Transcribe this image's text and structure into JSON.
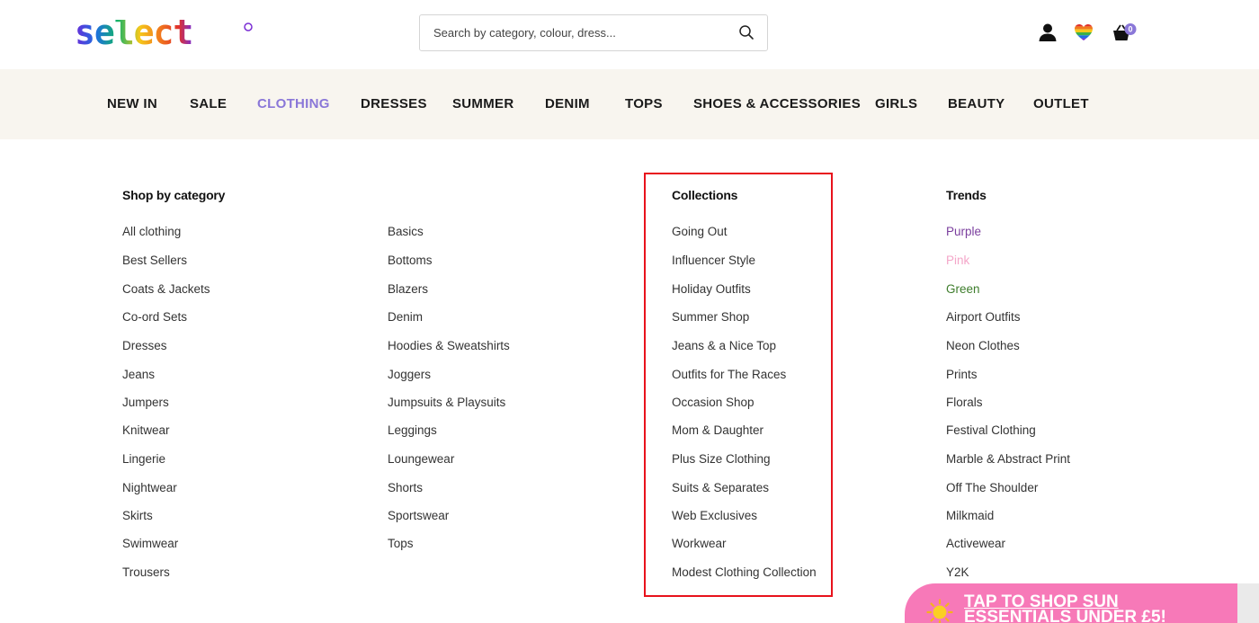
{
  "brand": {
    "logo_text": "select"
  },
  "search": {
    "placeholder": "Search by category, colour, dress..."
  },
  "header_icons": {
    "account": "user-icon",
    "wishlist": "rainbow-heart-icon",
    "basket": "basket-icon",
    "basket_count": "0"
  },
  "nav": {
    "items": [
      "NEW IN",
      "SALE",
      "CLOTHING",
      "DRESSES",
      "SUMMER",
      "DENIM",
      "TOPS",
      "SHOES & ACCESSORIES",
      "GIRLS",
      "BEAUTY",
      "OUTLET"
    ],
    "active": "CLOTHING"
  },
  "menu": {
    "shop_by_category": {
      "heading": "Shop by category",
      "col1": [
        "All clothing",
        "Best Sellers",
        "Coats & Jackets",
        "Co-ord Sets",
        "Dresses",
        "Jeans",
        "Jumpers",
        "Knitwear",
        "Lingerie",
        "Nightwear",
        "Skirts",
        "Swimwear",
        "Trousers"
      ],
      "col2": [
        "Basics",
        "Bottoms",
        "Blazers",
        "Denim",
        "Hoodies & Sweatshirts",
        "Joggers",
        "Jumpsuits & Playsuits",
        "Leggings",
        "Loungewear",
        "Shorts",
        "Sportswear",
        "Tops"
      ]
    },
    "collections": {
      "heading": "Collections",
      "items": [
        "Going Out",
        "Influencer Style",
        "Holiday Outfits",
        "Summer Shop",
        "Jeans & a Nice Top",
        "Outfits for The Races",
        "Occasion Shop",
        "Mom & Daughter",
        "Plus Size Clothing",
        "Suits & Separates",
        "Web Exclusives",
        "Workwear",
        "Modest Clothing Collection"
      ]
    },
    "trends": {
      "heading": "Trends",
      "items": [
        "Purple",
        "Pink",
        "Green",
        "Airport Outfits",
        "Neon Clothes",
        "Prints",
        "Florals",
        "Festival Clothing",
        "Marble & Abstract Print",
        "Off The Shoulder",
        "Milkmaid",
        "Activewear",
        "Y2K"
      ],
      "colors": {
        "Purple": "#7b3f9e",
        "Pink": "#f4a6c8",
        "Green": "#3e7d2c"
      }
    }
  },
  "promo": {
    "text": "TAP TO SHOP SUN ESSENTIALS UNDER £5!",
    "icon": "sun-icon"
  },
  "colors": {
    "accent_nav": "#8a77d8",
    "nav_bg": "#f8f5ef",
    "highlight": "#e8121c",
    "promo_bg": "#f779b8"
  }
}
